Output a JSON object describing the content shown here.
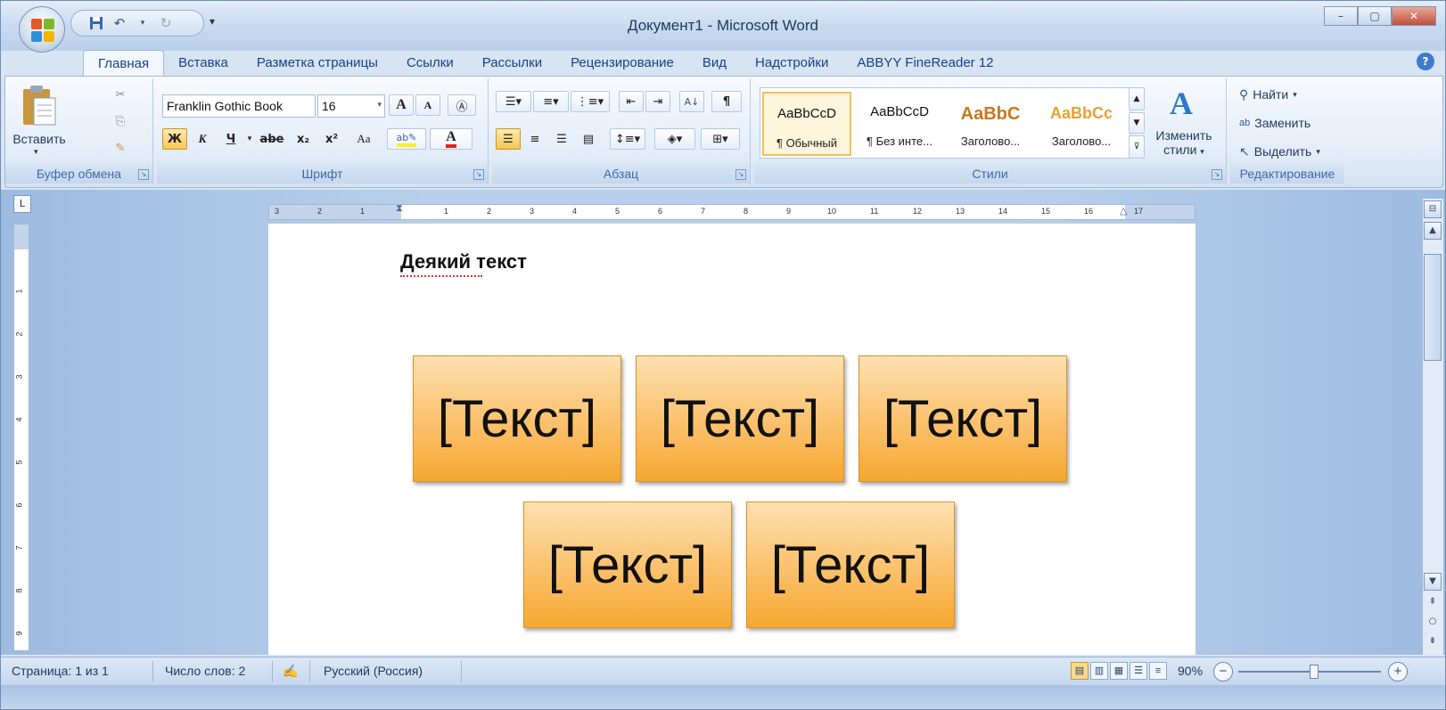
{
  "window": {
    "title": "Документ1 - Microsoft Word",
    "minimize": "–",
    "maximize": "▢",
    "close": "✕"
  },
  "tabs": [
    "Главная",
    "Вставка",
    "Разметка страницы",
    "Ссылки",
    "Рассылки",
    "Рецензирование",
    "Вид",
    "Надстройки",
    "ABBYY FineReader 12"
  ],
  "active_tab": "Главная",
  "ribbon": {
    "clipboard": {
      "label": "Буфер обмена",
      "paste": "Вставить"
    },
    "font": {
      "label": "Шрифт",
      "name": "Franklin Gothic Book",
      "size": "16",
      "bold": "Ж",
      "italic": "К",
      "underline": "Ч",
      "strike": "abe",
      "subscript": "x₂",
      "superscript": "x²",
      "change_case": "Aa",
      "grow": "A",
      "shrink": "A",
      "font_color": "A"
    },
    "paragraph": {
      "label": "Абзац",
      "sort": "A↓",
      "show_marks": "¶"
    },
    "styles": {
      "label": "Стили",
      "items": [
        {
          "sample": "AaBbCcD",
          "name": "¶ Обычный"
        },
        {
          "sample": "AaBbCcD",
          "name": "¶ Без инте..."
        },
        {
          "sample": "AaBbC",
          "name": "Заголово..."
        },
        {
          "sample": "AaBbCc",
          "name": "Заголово..."
        }
      ],
      "change_styles_line1": "Изменить",
      "change_styles_line2": "стили"
    },
    "editing": {
      "label": "Редактирование",
      "find": "Найти",
      "replace": "Заменить",
      "select": "Выделить"
    }
  },
  "document": {
    "heading": "Деякий текст",
    "boxes": [
      "[Текст]",
      "[Текст]",
      "[Текст]",
      "[Текст]",
      "[Текст]"
    ]
  },
  "ruler": {
    "h_ticks": [
      "3",
      "2",
      "1",
      "1",
      "2",
      "3",
      "4",
      "5",
      "6",
      "7",
      "8",
      "9",
      "10",
      "11",
      "12",
      "13",
      "14",
      "15",
      "16",
      "17"
    ],
    "v_ticks": [
      "1",
      "2",
      "3",
      "4",
      "5",
      "6",
      "7",
      "8",
      "9"
    ]
  },
  "status": {
    "page": "Страница: 1 из 1",
    "words": "Число слов: 2",
    "language": "Русский (Россия)",
    "zoom": "90%"
  },
  "colors": {
    "box_top": "#fde0b0",
    "box_bottom": "#f6a830",
    "accent": "#15428b"
  }
}
